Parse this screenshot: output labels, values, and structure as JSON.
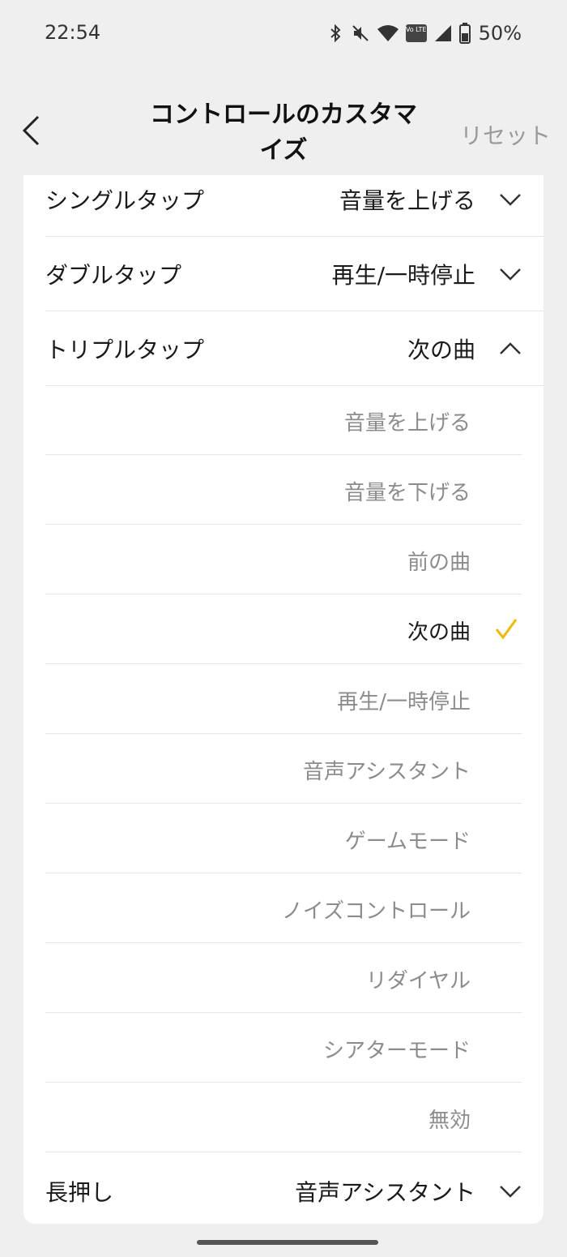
{
  "status_bar": {
    "time": "22:54",
    "battery_percent": "50%",
    "volte_label": "Vo LTE"
  },
  "header": {
    "title": "コントロールのカスタマイズ",
    "reset_label": "リセット"
  },
  "controls": {
    "single_tap": {
      "label": "シングルタップ",
      "value": "音量を上げる",
      "expanded": false
    },
    "double_tap": {
      "label": "ダブルタップ",
      "value": "再生/一時停止",
      "expanded": false
    },
    "triple_tap": {
      "label": "トリプルタップ",
      "value": "次の曲",
      "expanded": true
    },
    "long_press": {
      "label": "長押し",
      "value": "音声アシスタント",
      "expanded": false
    }
  },
  "options": [
    {
      "label": "音量を上げる",
      "selected": false
    },
    {
      "label": "音量を下げる",
      "selected": false
    },
    {
      "label": "前の曲",
      "selected": false
    },
    {
      "label": "次の曲",
      "selected": true
    },
    {
      "label": "再生/一時停止",
      "selected": false
    },
    {
      "label": "音声アシスタント",
      "selected": false
    },
    {
      "label": "ゲームモード",
      "selected": false
    },
    {
      "label": "ノイズコントロール",
      "selected": false
    },
    {
      "label": "リダイヤル",
      "selected": false
    },
    {
      "label": "シアターモード",
      "selected": false
    },
    {
      "label": "無効",
      "selected": false
    }
  ],
  "colors": {
    "accent_check": "#f5b800",
    "background": "#efefef",
    "card": "#ffffff",
    "muted_text": "#8c8c8c"
  }
}
